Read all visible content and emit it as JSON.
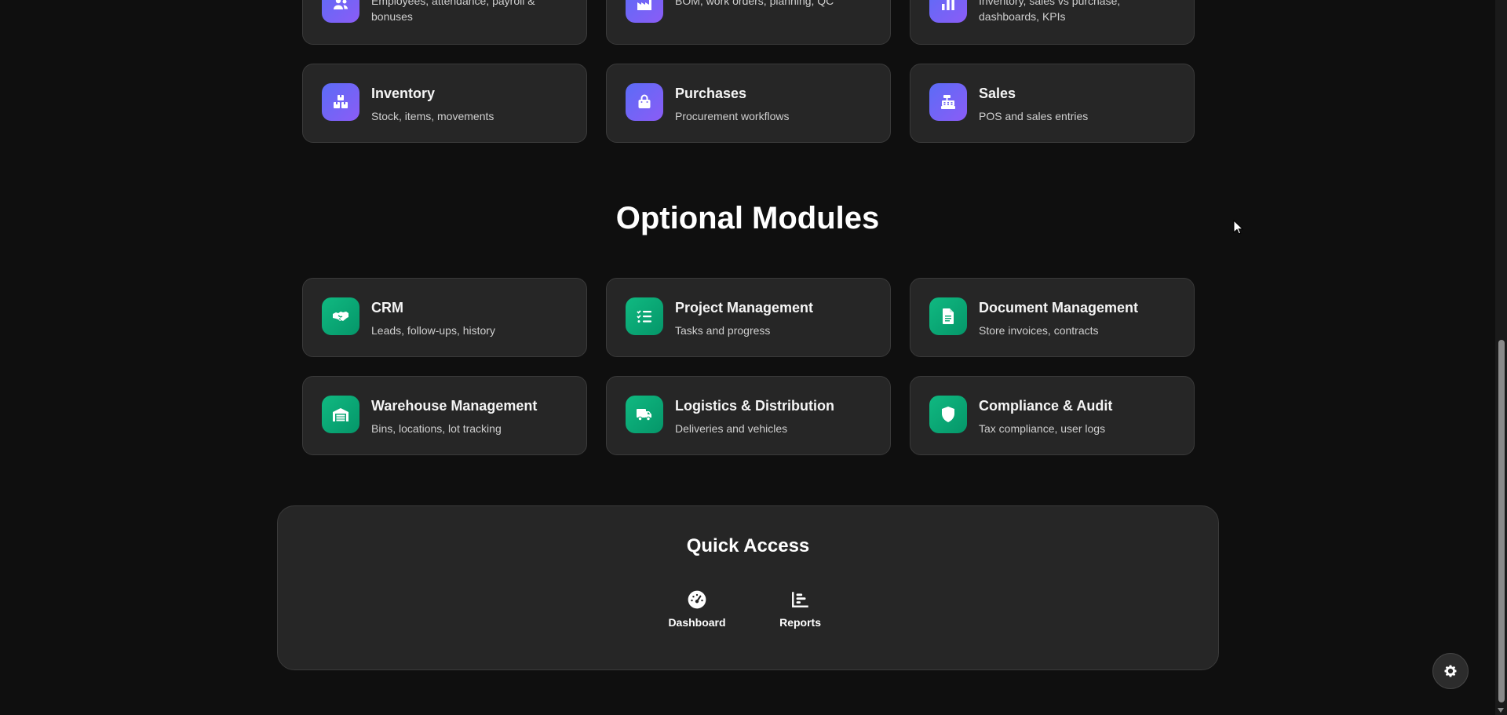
{
  "core_modules": [
    {
      "title": "",
      "desc": "Employees, attendance, payroll & bonuses",
      "icon": "users-icon",
      "color": "#6366f1"
    },
    {
      "title": "",
      "desc": "BOM, work orders, planning, QC",
      "icon": "factory-icon",
      "color": "#6366f1"
    },
    {
      "title": "",
      "desc": "Inventory, sales vs purchase, dashboards, KPIs",
      "icon": "chart-icon",
      "color": "#6366f1"
    },
    {
      "title": "Inventory",
      "desc": "Stock, items, movements",
      "icon": "boxes-icon",
      "color": "#6366f1"
    },
    {
      "title": "Purchases",
      "desc": "Procurement workflows",
      "icon": "shopping-bag-icon",
      "color": "#6366f1"
    },
    {
      "title": "Sales",
      "desc": "POS and sales entries",
      "icon": "cash-register-icon",
      "color": "#6366f1"
    }
  ],
  "optional_section": {
    "title": "Optional Modules"
  },
  "optional_modules": [
    {
      "title": "CRM",
      "desc": "Leads, follow-ups, history",
      "icon": "handshake-icon",
      "color": "#10b981"
    },
    {
      "title": "Project Management",
      "desc": "Tasks and progress",
      "icon": "task-list-icon",
      "color": "#10b981"
    },
    {
      "title": "Document Management",
      "desc": "Store invoices, contracts",
      "icon": "document-icon",
      "color": "#10b981"
    },
    {
      "title": "Warehouse Management",
      "desc": "Bins, locations, lot tracking",
      "icon": "warehouse-icon",
      "color": "#10b981"
    },
    {
      "title": "Logistics & Distribution",
      "desc": "Deliveries and vehicles",
      "icon": "truck-icon",
      "color": "#10b981"
    },
    {
      "title": "Compliance & Audit",
      "desc": "Tax compliance, user logs",
      "icon": "shield-icon",
      "color": "#10b981"
    }
  ],
  "quick_access": {
    "title": "Quick Access",
    "links": [
      {
        "label": "Dashboard",
        "icon": "gauge-icon"
      },
      {
        "label": "Reports",
        "icon": "bar-chart-icon"
      }
    ]
  },
  "settings_button": {
    "icon": "gear-icon"
  }
}
